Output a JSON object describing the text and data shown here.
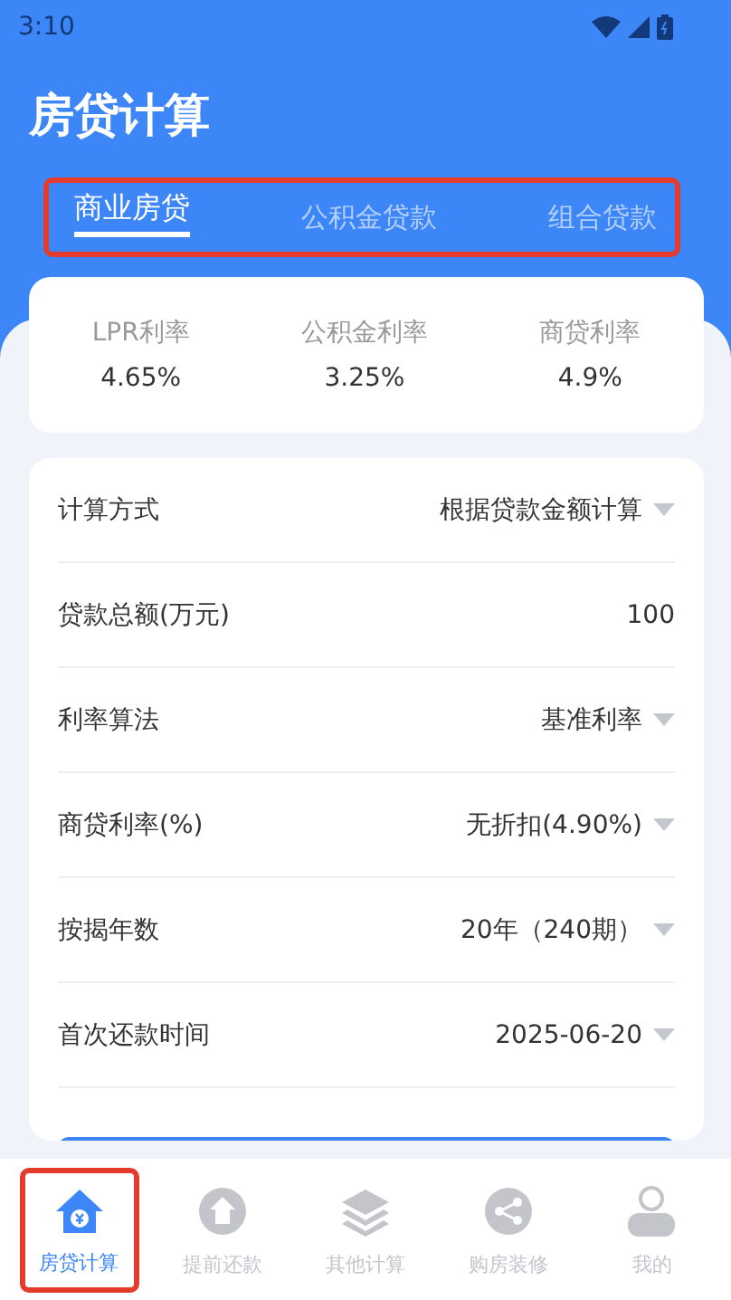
{
  "status_bar": {
    "time": "3:10"
  },
  "title": "房贷计算",
  "tabs_highlighted": true,
  "tabs": [
    {
      "label": "商业房贷",
      "selected": true
    },
    {
      "label": "公积金贷款",
      "selected": false
    },
    {
      "label": "组合贷款",
      "selected": false
    }
  ],
  "rates": [
    {
      "label": "LPR利率",
      "value": "4.65%"
    },
    {
      "label": "公积金利率",
      "value": "3.25%"
    },
    {
      "label": "商贷利率",
      "value": "4.9%"
    }
  ],
  "form": [
    {
      "label": "计算方式",
      "value": "根据贷款金额计算",
      "kind": "select"
    },
    {
      "label": "贷款总额(万元)",
      "value": "100",
      "kind": "input"
    },
    {
      "label": "利率算法",
      "value": "基准利率",
      "kind": "select"
    },
    {
      "label": "商贷利率(%)",
      "value": "无折扣(4.90%)",
      "kind": "select"
    },
    {
      "label": "按揭年数",
      "value": "20年（240期）",
      "kind": "select"
    },
    {
      "label": "首次还款时间",
      "value": "2025-06-20",
      "kind": "select"
    }
  ],
  "nav": [
    {
      "label": "房贷计算",
      "kind": "house",
      "selected": true,
      "highlighted": true
    },
    {
      "label": "提前还款",
      "kind": "upload",
      "selected": false,
      "highlighted": false
    },
    {
      "label": "其他计算",
      "kind": "layers",
      "selected": false,
      "highlighted": false
    },
    {
      "label": "购房装修",
      "kind": "share",
      "selected": false,
      "highlighted": false
    },
    {
      "label": "我的",
      "kind": "person",
      "selected": false,
      "highlighted": false
    }
  ]
}
